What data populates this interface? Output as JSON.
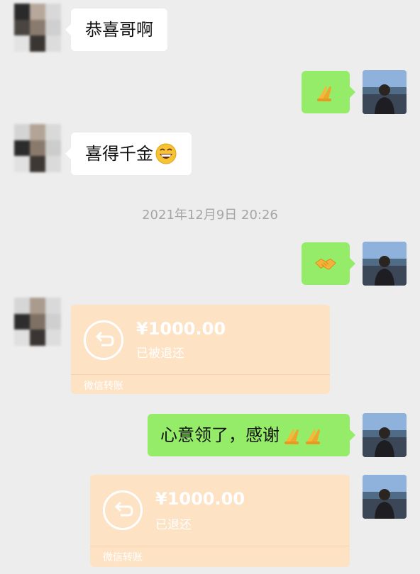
{
  "messages": [
    {
      "side": "left",
      "text": "恭喜哥啊"
    },
    {
      "side": "right",
      "emoji": "folded-hands-icon"
    },
    {
      "side": "left",
      "text": "喜得千金"
    },
    {
      "side": "right",
      "emoji": "handshake-icon"
    },
    {
      "side": "left",
      "transfer": {
        "amount": "¥1000.00",
        "status": "已被退还",
        "footer": "微信转账"
      }
    },
    {
      "side": "right",
      "text": "心意领了，感谢"
    },
    {
      "side": "right",
      "transfer": {
        "amount": "¥1000.00",
        "status": "已退还",
        "footer": "微信转账"
      }
    }
  ],
  "timestamp": "2021年12月9日 20:26",
  "colors": {
    "background": "#ededed",
    "bubble_self": "#95ec69",
    "bubble_other": "#ffffff",
    "transfer_card": "#fde2c4",
    "timestamp_text": "#a6a6a6"
  }
}
